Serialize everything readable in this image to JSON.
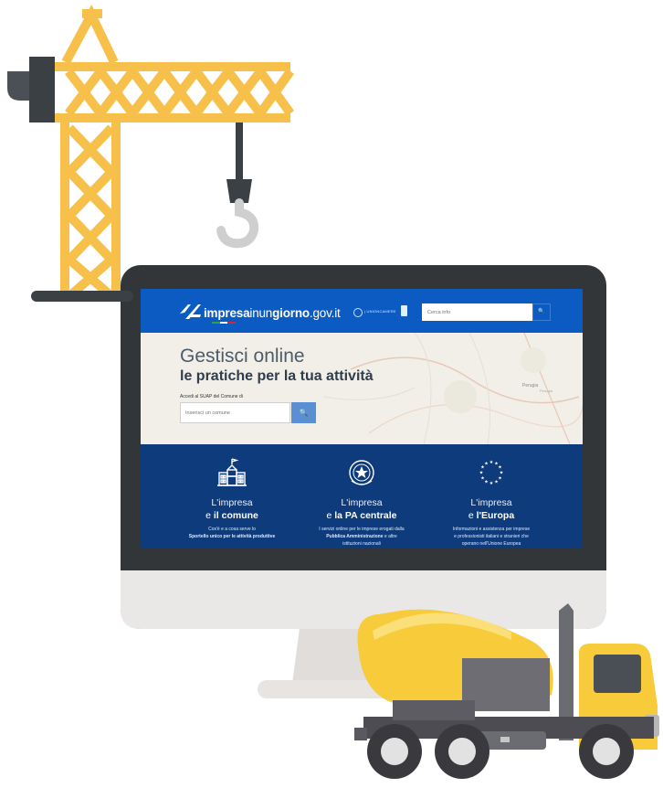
{
  "colors": {
    "crane": "#f6c04a",
    "crane_stroke": "#e9a93a",
    "monitor_bezel": "#333638",
    "monitor_chin": "#eae8e7",
    "stand": "#e0dddb",
    "truck_drum": "#f8cb3b",
    "truck_cab": "#f8cb3b",
    "truck_chassis": "#4d4c52",
    "site_header": "#0b5bc2",
    "services_band": "#0e3b7c"
  },
  "icons": {
    "crane": "crane-icon",
    "hook": "hook-icon",
    "truck": "cement-mixer-truck-icon",
    "search": "search-icon",
    "town_hall": "town-hall-icon",
    "emblem": "italian-republic-emblem-icon",
    "eu": "eu-stars-icon"
  },
  "site": {
    "logo": {
      "bold_prefix": "impresa",
      "thin_mid": "inun",
      "bold_mid": "giorno",
      "suffix": ".gov.it"
    },
    "partner": "| UNIONCAMERE",
    "search_placeholder": "Cerca info",
    "search_button": "🔍"
  },
  "hero": {
    "title": "Gestisci online",
    "subtitle": "le pratiche per la tua attività",
    "suap_label": "Accedi al SUAP del Comune di",
    "comune_placeholder": "Inserisci un comune",
    "map_city": "Perugia",
    "map_city_small": "Perugia"
  },
  "services": [
    {
      "line1": "L'impresa",
      "line2_prefix": "e ",
      "line2_bold": "il comune",
      "desc1": "Cos'è e a cosa serve lo",
      "desc2": "Sportello unico per le attività produttive",
      "desc3": ""
    },
    {
      "line1": "L'impresa",
      "line2_prefix": "e ",
      "line2_bold": "la PA centrale",
      "desc1": "I servizi online per le imprese erogati dalla",
      "desc2_bold": "Pubblica Amministrazione",
      "desc2_rest": " e altre",
      "desc3": "istituzioni nazionali"
    },
    {
      "line1": "L'impresa",
      "line2_prefix": "e ",
      "line2_bold": "l'Europa",
      "desc1": "Informazioni e assistenza per imprese",
      "desc2": "e professionisti italiani e stranieri che",
      "desc3": "operano nell'Unione Europea"
    }
  ]
}
